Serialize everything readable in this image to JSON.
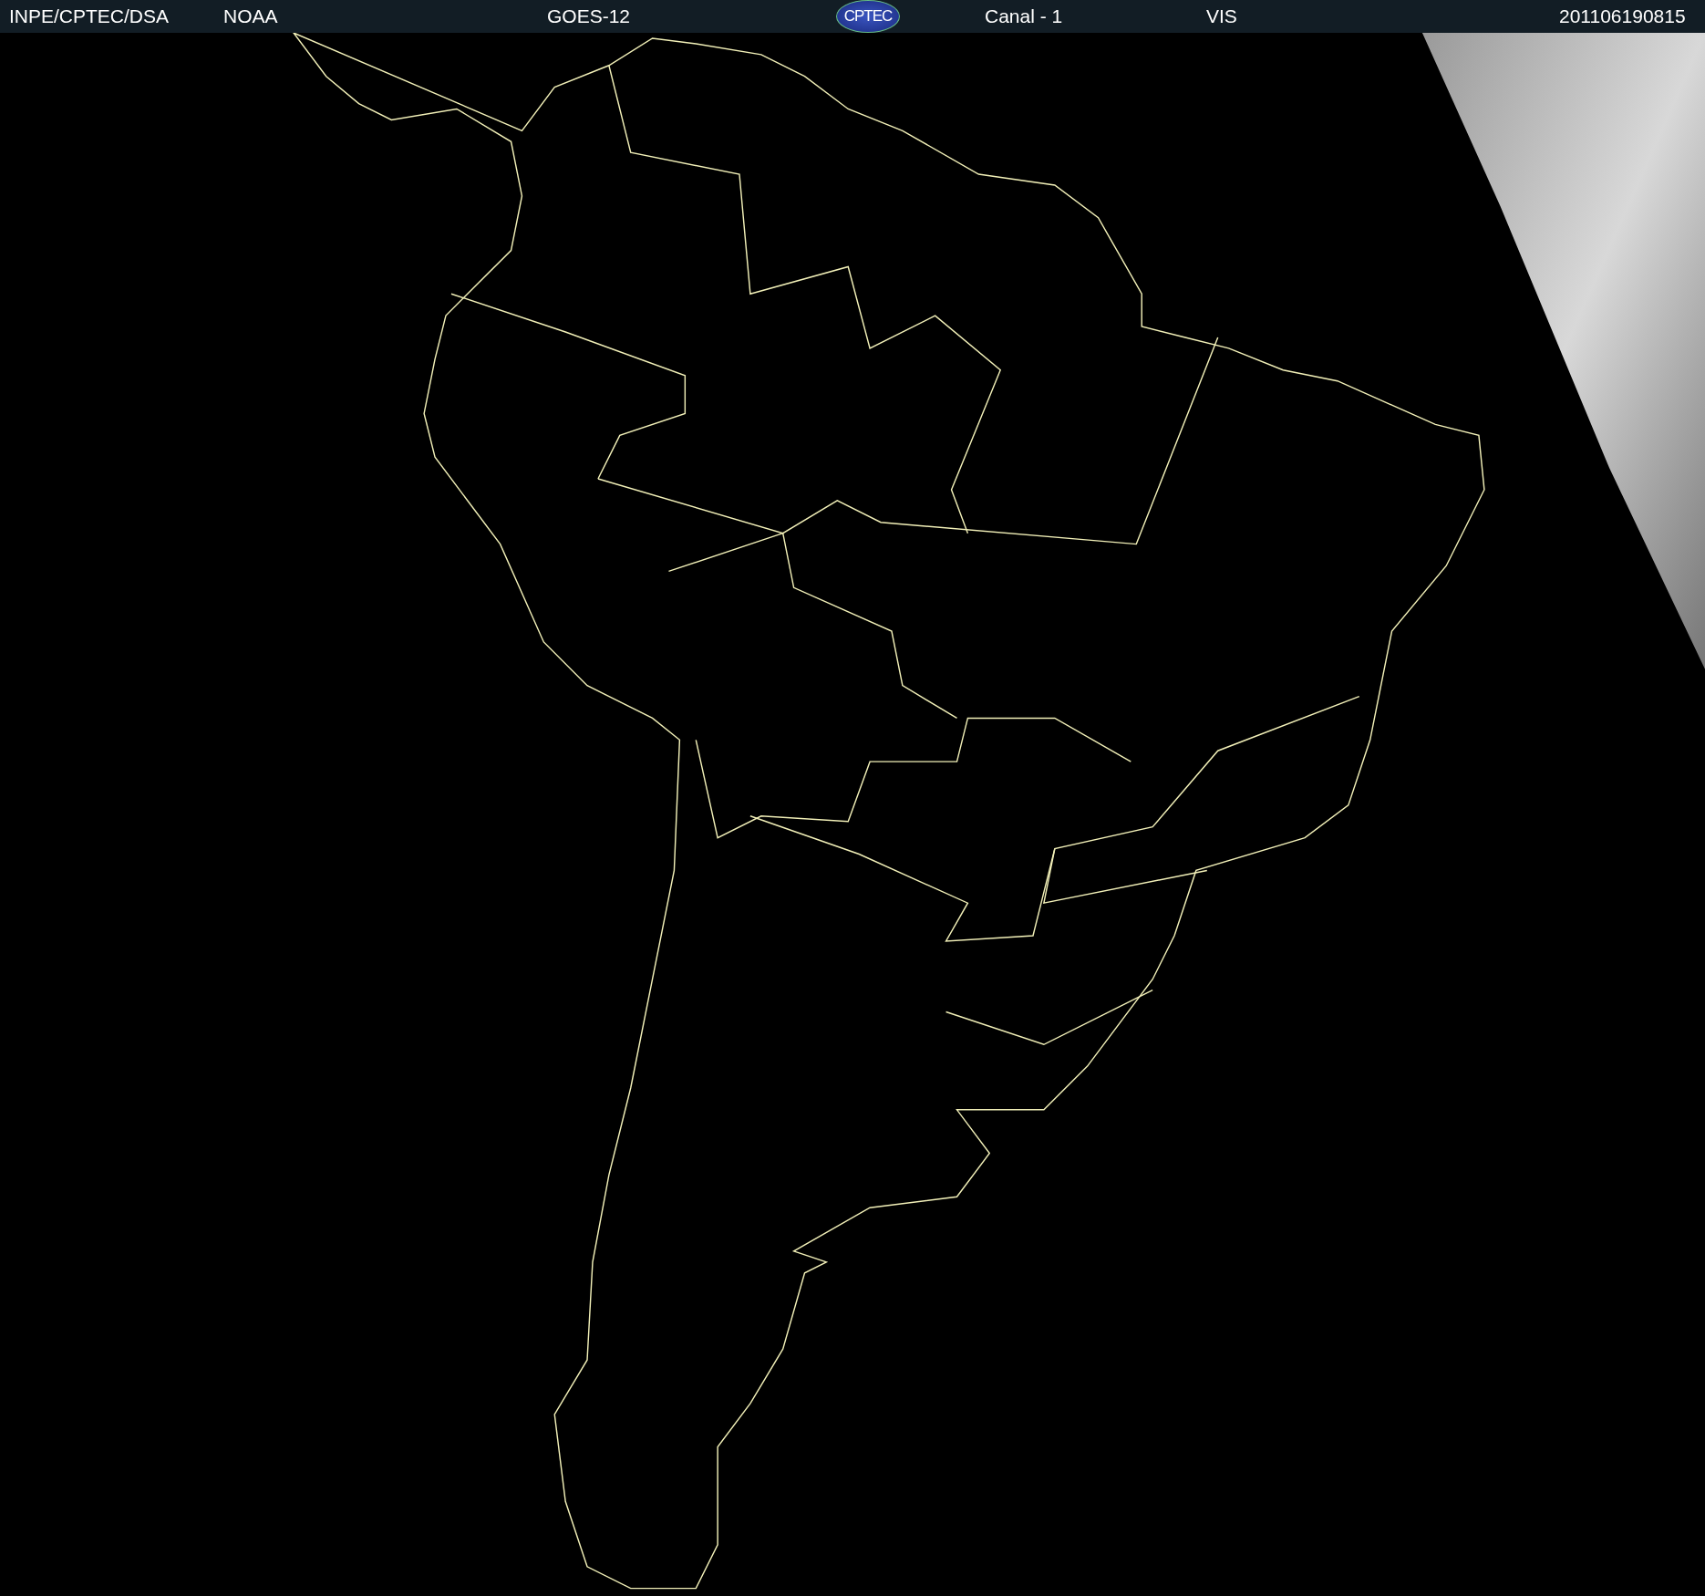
{
  "header": {
    "items": [
      {
        "kind": "text",
        "text": "INPE/CPTEC/DSA"
      },
      {
        "kind": "text",
        "text": "NOAA"
      },
      {
        "kind": "text",
        "text": "GOES-12"
      },
      {
        "kind": "logo",
        "text": "CPTEC"
      },
      {
        "kind": "text",
        "text": "Canal - 1"
      },
      {
        "kind": "text",
        "text": "VIS"
      },
      {
        "kind": "text",
        "text": "201106190815"
      }
    ]
  }
}
